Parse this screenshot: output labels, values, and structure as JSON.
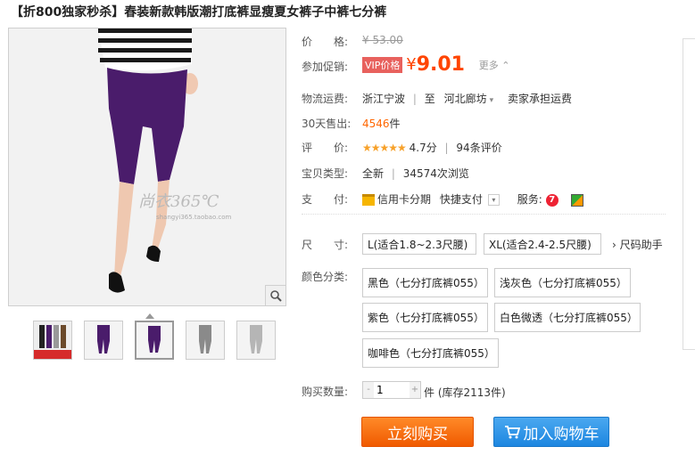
{
  "title": "【折800独家秒杀】春装新款韩版潮打底裤显瘦夏女裤子中裤七分裤",
  "gallery": {
    "watermark_main": "尚衣365℃",
    "watermark_sub": "shangyi365.taobao.com",
    "zoom_icon": "magnifier-icon",
    "thumbnails": [
      "thumb-1",
      "thumb-2",
      "thumb-3",
      "thumb-4",
      "thumb-5"
    ],
    "thumb1_badge": "打底长裤 全新"
  },
  "price": {
    "label": "价　　格:",
    "original": "¥ 53.00"
  },
  "promo": {
    "label": "参加促销:",
    "vip_tag": "VIP价格",
    "yen": "¥",
    "price": "9.01",
    "more": "更多"
  },
  "shipping": {
    "label": "物流运费:",
    "from": "浙江宁波",
    "to_word": "至",
    "to": "河北廊坊",
    "note": "卖家承担运费"
  },
  "sales": {
    "label": "30天售出:",
    "count": "4546",
    "unit": "件"
  },
  "rating": {
    "label": "评　　价:",
    "stars": "★★★★★",
    "score": "4.7分",
    "reviews": "94条评价"
  },
  "item_type": {
    "label": "宝贝类型:",
    "condition": "全新",
    "views": "34574次浏览"
  },
  "payment": {
    "label": "支　　付:",
    "credit": "信用卡分期",
    "quick": "快捷支付",
    "service_label": "服务:",
    "service_7": "7"
  },
  "size": {
    "label": "尺　　寸:",
    "options": [
      "L(适合1.8~2.3尺腰)",
      "XL(适合2.4-2.5尺腰)"
    ],
    "helper": "尺码助手"
  },
  "color": {
    "label": "颜色分类:",
    "options": [
      "黑色（七分打底裤055）",
      "浅灰色（七分打底裤055）",
      "紫色（七分打底裤055）",
      "白色微透（七分打底裤055）",
      "咖啡色（七分打底裤055）"
    ]
  },
  "quantity": {
    "label": "购买数量:",
    "value": "1",
    "stock": "件 (库存2113件)"
  },
  "buttons": {
    "buy": "立刻购买",
    "cart": "加入购物车"
  },
  "colors": {
    "accent": "#ff4400",
    "buy_button": "#f56c12",
    "cart_button": "#2b90e3",
    "vip_tag": "#e8615d"
  }
}
